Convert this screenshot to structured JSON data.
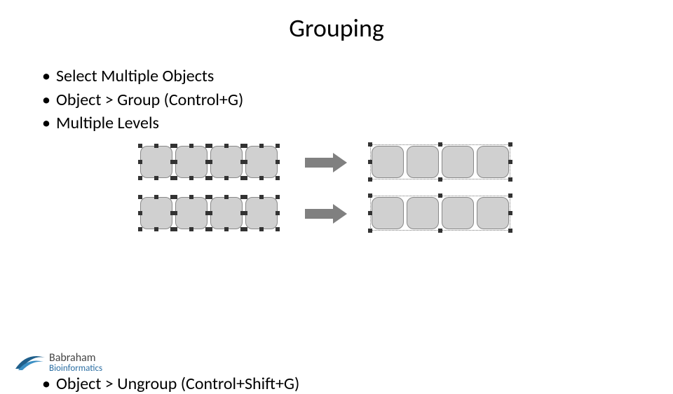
{
  "title": "Grouping",
  "bullets_top": [
    "Select Multiple Objects",
    "Object > Group (Control+G)",
    "Multiple Levels"
  ],
  "bullets_bottom": [
    "Object > Ungroup (Control+Shift+G)"
  ],
  "logo": {
    "line1": "Babraham",
    "line2": "Bioinformatics"
  },
  "diagram": {
    "left_rows": 2,
    "right_rows": 2,
    "squares_per_row": 4,
    "selection_left_mode": "individual",
    "selection_right_mode": "grouped"
  },
  "colors": {
    "square_fill": "#d0d0d0",
    "square_border": "#888888",
    "arrow": "#808080",
    "logo_swoosh_outer": "#1f5f8b",
    "logo_swoosh_inner": "#3b8fc4"
  }
}
